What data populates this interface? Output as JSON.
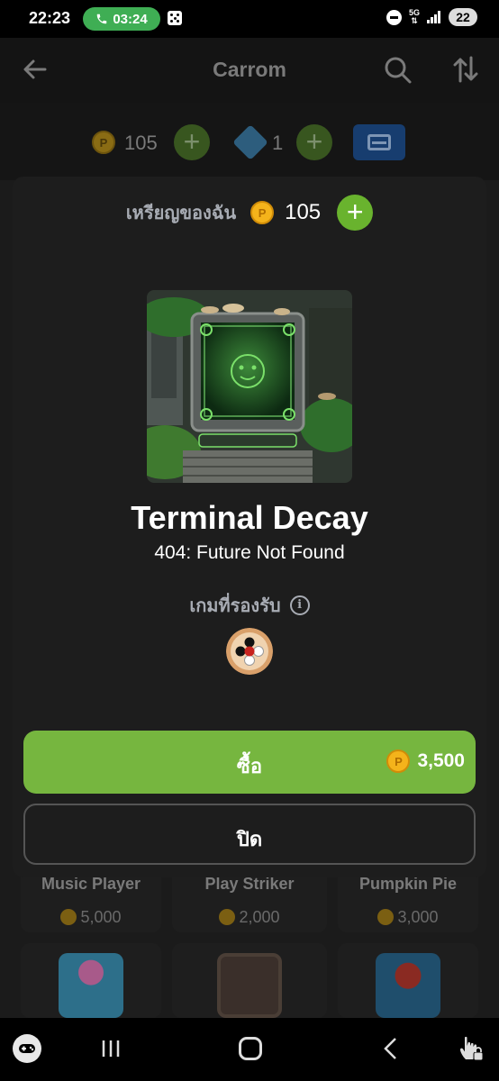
{
  "status_bar": {
    "time": "22:23",
    "call_timer": "03:24",
    "network": "5G",
    "battery": "22"
  },
  "app_bar": {
    "title": "Carrom"
  },
  "currency_bar": {
    "coins": "105",
    "gems": "1"
  },
  "background_items": [
    {
      "name": "Music Player",
      "price": "5,000"
    },
    {
      "name": "Play Striker",
      "price": "2,000"
    },
    {
      "name": "Pumpkin Pie",
      "price": "3,000"
    }
  ],
  "modal": {
    "balance_label": "เหรียญของฉัน",
    "balance_value": "105",
    "item_title": "Terminal Decay",
    "item_subtitle": "404: Future Not Found",
    "supported_label": "เกมที่รองรับ",
    "buy_label": "ซื้อ",
    "price": "3,500",
    "close_label": "ปิด"
  },
  "icons": {
    "coin": "coin-icon",
    "gem": "gem-icon",
    "info": "info-icon",
    "wallet": "wallet-icon"
  },
  "colors": {
    "primary_green": "#76b63f",
    "plus_green": "#69b32e",
    "coin_gold": "#f4b31b",
    "modal_bg": "#1d1d1d",
    "wallet_blue": "#173d6f"
  }
}
